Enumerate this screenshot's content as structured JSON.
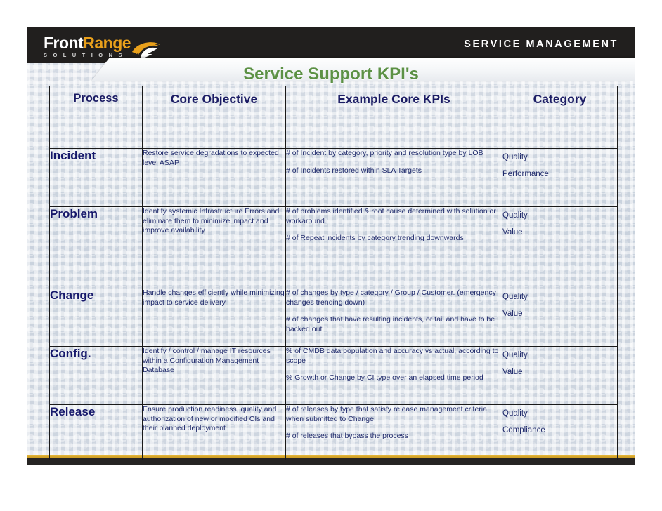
{
  "brand": {
    "logo_primary": "Front",
    "logo_accent": "Range",
    "logo_subtitle": "S O L U T I O N S",
    "logo_accent_color": "#e9a01b",
    "tagline": "SERVICE MANAGEMENT",
    "band_color": "#211f1e",
    "rule_color": "#c8971f"
  },
  "slide": {
    "title": "Service Support KPI's",
    "title_color": "#5c9145"
  },
  "table": {
    "headers": [
      {
        "label": "Process"
      },
      {
        "label": "Core Objective"
      },
      {
        "label": "Example Core KPIs"
      },
      {
        "label": "Category"
      }
    ],
    "rows": [
      {
        "process": "Incident",
        "objective": "Restore service degradations to expected level ASAP",
        "kpis": [
          "# of Incident by category, priority and resolution type by LOB",
          "# of Incidents restored within SLA Targets"
        ],
        "categories": [
          "Quality",
          "Performance"
        ]
      },
      {
        "process": "Problem",
        "objective": "Identify systemic Infrastructure Errors and eliminate them to minimize impact and improve availability",
        "kpis": [
          "# of problems identified & root cause determined with solution or workaround.",
          "# of Repeat incidents by category trending downwards"
        ],
        "categories": [
          "Quality",
          "Value"
        ]
      },
      {
        "process": "Change",
        "objective": "Handle changes efficiently while minimizing impact to service delivery",
        "kpis": [
          "# of changes by type / category / Group / Customer. (emergency changes trending down)",
          "# of changes that have resulting incidents, or fail and have to be backed out"
        ],
        "categories": [
          "Quality",
          "Value"
        ]
      },
      {
        "process": "Config.",
        "objective": "Identify / control / manage IT resources within a Configuration Management Database",
        "kpis": [
          "% of CMDB data population and accuracy vs actual, according to scope",
          "% Growth or Change by CI type over an elapsed time period"
        ],
        "categories": [
          "Quality",
          "Value"
        ]
      },
      {
        "process": "Release",
        "objective": "Ensure production readiness, quality and authorization of new or modified CIs and their planned deployment",
        "kpis": [
          "# of releases by type that satisfy release management criteria when submitted to Change",
          "# of releases that bypass the process"
        ],
        "categories": [
          "Quality",
          "Compliance"
        ]
      }
    ]
  }
}
